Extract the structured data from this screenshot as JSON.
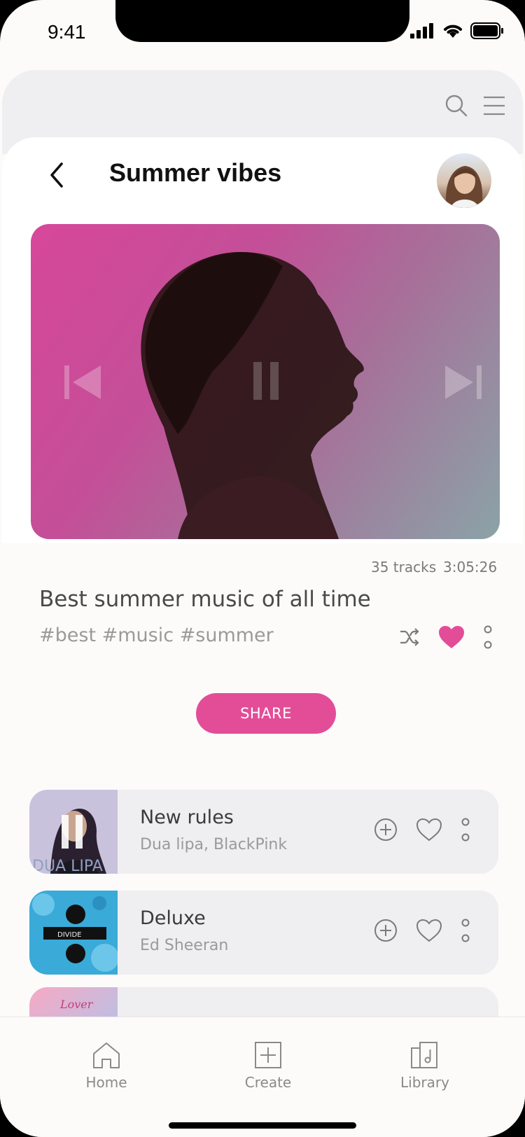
{
  "status_bar": {
    "time": "9:41"
  },
  "header": {
    "title": "Summer vibes"
  },
  "playlist": {
    "tracks_count": "35 tracks",
    "duration": "3:05:26",
    "description": "Best summer music of all time",
    "tags": "#best #music #summer",
    "share_label": "SHARE",
    "accent_color": "#e34d98"
  },
  "tracks": [
    {
      "name": "New rules",
      "artist": "Dua lipa, BlackPink",
      "art_text": "DUA LIPA"
    },
    {
      "name": "Deluxe",
      "artist": "Ed Sheeran",
      "art_text": "DIVIDE"
    },
    {
      "name": "",
      "artist": "",
      "art_text": "Lover"
    }
  ],
  "nav": {
    "home": "Home",
    "create": "Create",
    "library": "Library"
  }
}
